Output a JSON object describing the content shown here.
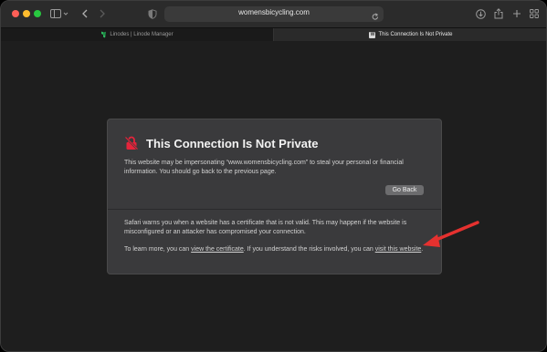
{
  "toolbar": {
    "url": "womensbicycling.com"
  },
  "tabs": [
    {
      "label": "Linodes | Linode Manager",
      "active": false
    },
    {
      "label": "This Connection Is Not Private",
      "active": true,
      "favicon_letter": "W"
    }
  ],
  "dialog": {
    "title": "This Connection Is Not Private",
    "body1": "This website may be impersonating “www.womensbicycling.com” to steal your personal or financial information. You should go back to the previous page.",
    "go_back_label": "Go Back",
    "body2": "Safari warns you when a website has a certificate that is not valid. This may happen if the website is misconfigured or an attacker has compromised your connection.",
    "body3_prefix": "To learn more, you can ",
    "view_cert_link": "view the certificate",
    "body3_middle": ". If you understand the risks involved, you can ",
    "visit_link": "visit this website",
    "body3_suffix": "."
  },
  "colors": {
    "warning_red": "#e5243b",
    "annotation_arrow": "#e5312f"
  }
}
